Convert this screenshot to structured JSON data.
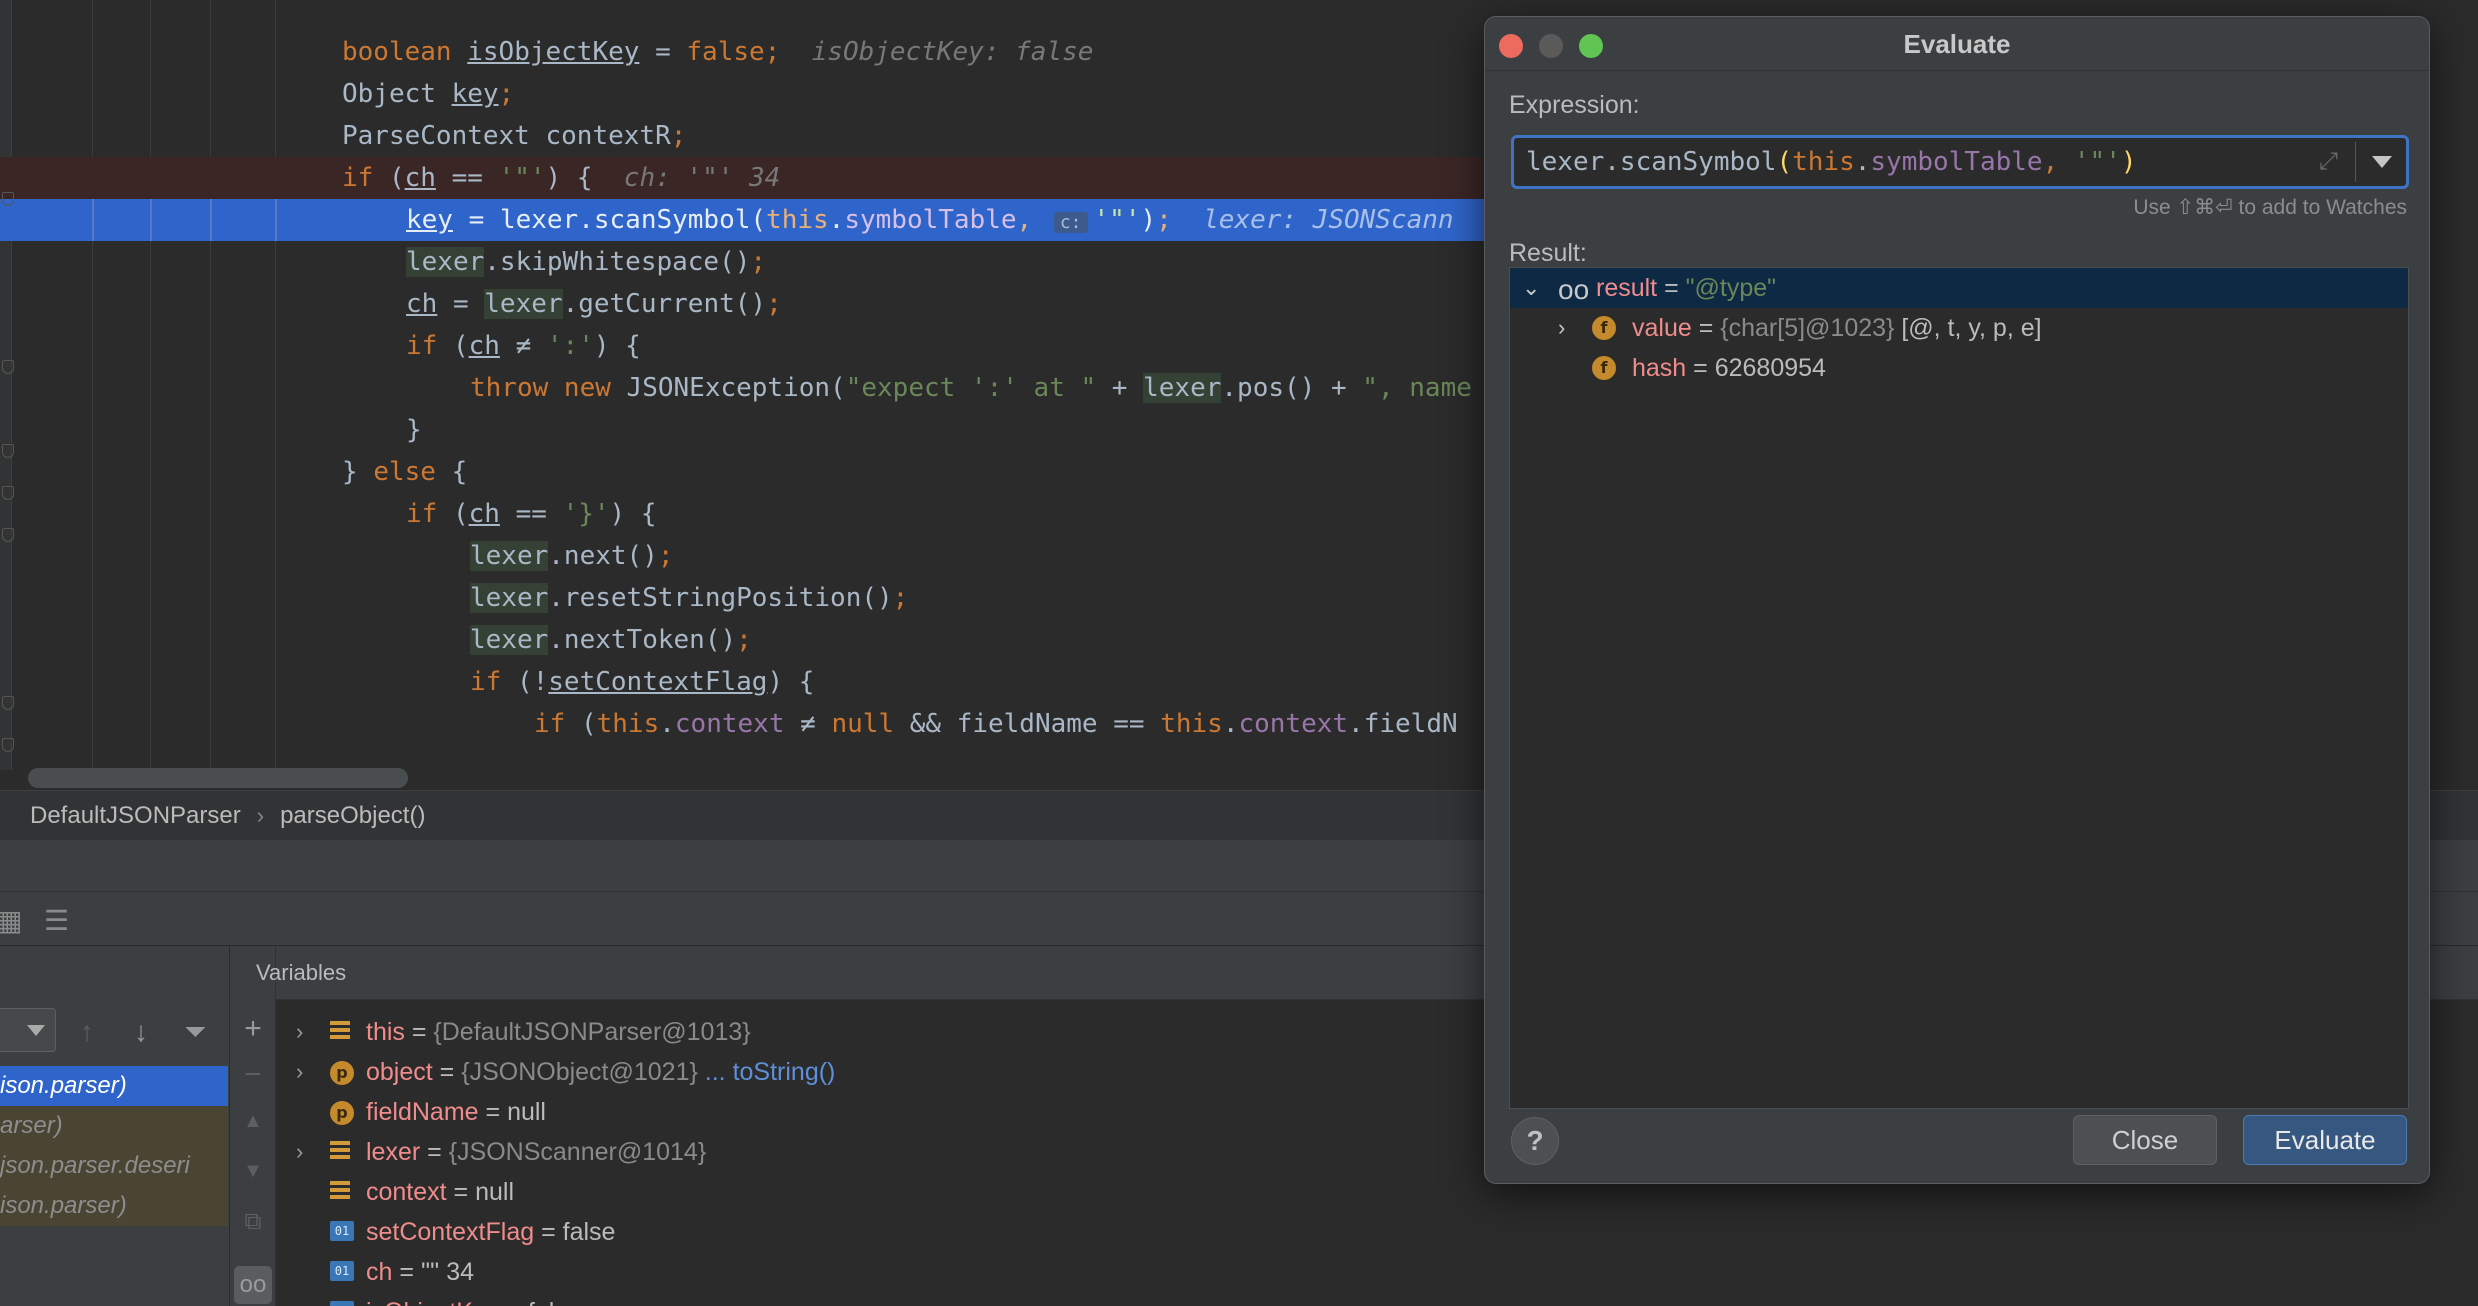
{
  "editor": {
    "lines": [
      {
        "segs": [
          [
            "kw",
            "boolean "
          ],
          [
            "uline",
            "isObjectKey"
          ],
          [
            "txt",
            " = "
          ],
          [
            "kw",
            "false"
          ],
          [
            "kw",
            ";"
          ],
          [
            "dbg",
            "  isObjectKey: false"
          ]
        ]
      },
      {
        "segs": [
          [
            "txt",
            "Object "
          ],
          [
            "uline",
            "key"
          ],
          [
            "kw",
            ";"
          ]
        ]
      },
      {
        "segs": [
          [
            "txt",
            "ParseContext contextR"
          ],
          [
            "kw",
            ";"
          ]
        ]
      },
      {
        "segs": [
          [
            "kw",
            "if "
          ],
          [
            "txt",
            "("
          ],
          [
            "uline",
            "ch"
          ],
          [
            "txt",
            " == "
          ],
          [
            "str",
            "'\"'"
          ],
          [
            "txt",
            ") {"
          ],
          [
            "dbg",
            "  ch: '\"' 34"
          ]
        ]
      },
      {
        "segs": [
          [
            "uline",
            "key"
          ],
          [
            "txt",
            " = "
          ],
          [
            "txt",
            "lexer.scanSymbol("
          ],
          [
            "kw",
            "this"
          ],
          [
            "txt",
            "."
          ],
          [
            "fld",
            "symbolTable"
          ],
          [
            "kw",
            ", "
          ],
          [
            "hint",
            "c:"
          ],
          [
            "str",
            "'\"'"
          ],
          [
            "txt",
            ")"
          ],
          [
            "kw",
            ";"
          ],
          [
            "dbg-cur",
            "  lexer: JSONScann"
          ]
        ]
      },
      {
        "segs": [
          [
            "hlvar",
            "lexer"
          ],
          [
            "txt",
            ".skipWhitespace()"
          ],
          [
            "kw",
            ";"
          ]
        ]
      },
      {
        "segs": [
          [
            "uline",
            "ch"
          ],
          [
            "txt",
            " = "
          ],
          [
            "hlvar",
            "lexer"
          ],
          [
            "txt",
            ".getCurrent()"
          ],
          [
            "kw",
            ";"
          ]
        ]
      },
      {
        "segs": [
          [
            "kw",
            "if "
          ],
          [
            "txt",
            "("
          ],
          [
            "uline",
            "ch"
          ],
          [
            "txt",
            " ≠ "
          ],
          [
            "str",
            "':'"
          ],
          [
            "txt",
            ") {"
          ]
        ]
      },
      {
        "segs": [
          [
            "kw",
            "throw new "
          ],
          [
            "txt",
            "JSONException("
          ],
          [
            "str",
            "\"expect ':' at \""
          ],
          [
            "txt",
            " + "
          ],
          [
            "hlvar",
            "lexer"
          ],
          [
            "txt",
            ".pos() + "
          ],
          [
            "str",
            "\", name"
          ]
        ]
      },
      {
        "segs": [
          [
            "txt",
            "}"
          ]
        ]
      },
      {
        "segs": [
          [
            "txt",
            "} "
          ],
          [
            "kw",
            "else "
          ],
          [
            "txt",
            "{"
          ]
        ]
      },
      {
        "segs": [
          [
            "kw",
            "if "
          ],
          [
            "txt",
            "("
          ],
          [
            "uline",
            "ch"
          ],
          [
            "txt",
            " == "
          ],
          [
            "str",
            "'}'"
          ],
          [
            "txt",
            ") {"
          ]
        ]
      },
      {
        "segs": [
          [
            "hlvar",
            "lexer"
          ],
          [
            "txt",
            ".next()"
          ],
          [
            "kw",
            ";"
          ]
        ]
      },
      {
        "segs": [
          [
            "hlvar",
            "lexer"
          ],
          [
            "txt",
            ".resetStringPosition()"
          ],
          [
            "kw",
            ";"
          ]
        ]
      },
      {
        "segs": [
          [
            "hlvar",
            "lexer"
          ],
          [
            "txt",
            ".nextToken()"
          ],
          [
            "kw",
            ";"
          ]
        ]
      },
      {
        "segs": [
          [
            "kw",
            "if "
          ],
          [
            "txt",
            "(!"
          ],
          [
            "uline",
            "setContextFlag"
          ],
          [
            "txt",
            ") {"
          ]
        ]
      },
      {
        "segs": [
          [
            "kw",
            "if "
          ],
          [
            "txt",
            "("
          ],
          [
            "kw",
            "this"
          ],
          [
            "txt",
            "."
          ],
          [
            "fld",
            "context"
          ],
          [
            "txt",
            " ≠ "
          ],
          [
            "kw",
            "null "
          ],
          [
            "txt",
            "&& fieldName == "
          ],
          [
            "kw",
            "this"
          ],
          [
            "txt",
            "."
          ],
          [
            "fld",
            "context"
          ],
          [
            "txt",
            ".fieldN"
          ]
        ]
      }
    ]
  },
  "breadcrumb": {
    "class_name": "DefaultJSONParser",
    "method_name": "parseObject()",
    "separator": "›"
  },
  "frames": {
    "items": [
      {
        "label": "ison.parser)",
        "state": "selected"
      },
      {
        "label": "arser)",
        "state": "normal"
      },
      {
        "label": "json.parser.deseri",
        "state": "normal"
      },
      {
        "label": "ison.parser)",
        "state": "normal"
      }
    ]
  },
  "variables": {
    "title": "Variables",
    "rows": [
      {
        "expand": true,
        "icon": "stack",
        "name": "this",
        "op": " = ",
        "value": "{DefaultJSONParser@1013}",
        "vclass": "vref"
      },
      {
        "expand": true,
        "icon": "p",
        "name": "object",
        "op": " = ",
        "value": "{JSONObject@1021}",
        "vclass": "vref",
        "link": " ... toString()"
      },
      {
        "expand": false,
        "icon": "p",
        "name": "fieldName",
        "op": " = ",
        "value": "null",
        "vclass": "vval"
      },
      {
        "expand": true,
        "icon": "stack",
        "name": "lexer",
        "op": " = ",
        "value": "{JSONScanner@1014}",
        "vclass": "vref"
      },
      {
        "expand": false,
        "icon": "stack",
        "name": "context",
        "op": " = ",
        "value": "null",
        "vclass": "vval"
      },
      {
        "expand": false,
        "icon": "prim",
        "name": "setContextFlag",
        "op": " = ",
        "value": "false",
        "vclass": "vval"
      },
      {
        "expand": false,
        "icon": "prim",
        "name": "ch",
        "op": " = ",
        "value": "'\"' 34",
        "vclass": "vval"
      },
      {
        "expand": false,
        "icon": "prim",
        "name": "isObjectKey",
        "op": " = ",
        "value": "false",
        "vclass": "vval"
      }
    ]
  },
  "evaluate": {
    "title": "Evaluate",
    "expression_label": "Expression:",
    "expression_value": {
      "a": "lexer.scanSymbol",
      "p1": "(",
      "b": "this",
      "c": ".",
      "d": "symbolTable",
      "e": ", ",
      "f": "'\"'",
      "p2": ")"
    },
    "watch_hint": "Use ⇧⌘⏎ to add to Watches",
    "result_label": "Result:",
    "tree": [
      {
        "name": "result",
        "op": " = ",
        "value": "\"@type\""
      },
      {
        "name": "value",
        "op": " = ",
        "ref": "{char[5]@1023}",
        "value": " [@, t, y, p, e]"
      },
      {
        "name": "hash",
        "op": " = ",
        "value": "62680954"
      }
    ],
    "help_label": "?",
    "close_label": "Close",
    "evaluate_label": "Evaluate"
  },
  "colors": {
    "accent": "#2f65ca",
    "close_red": "#ed6a5e",
    "minimize_yellow": "#5a5a5a",
    "zoom_green": "#61c554"
  }
}
